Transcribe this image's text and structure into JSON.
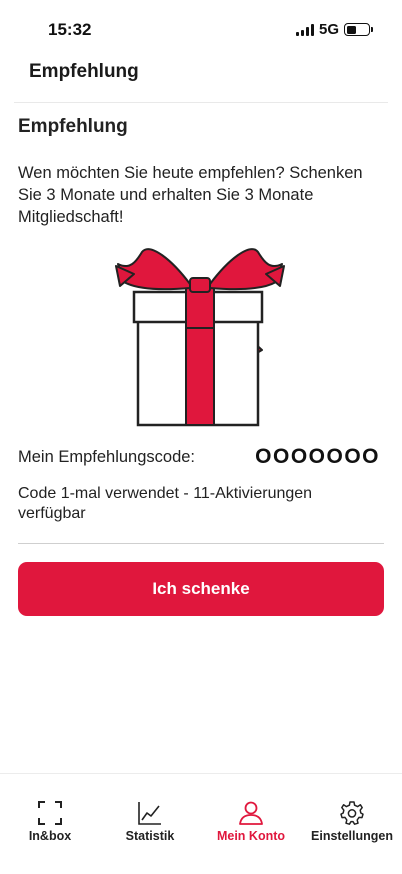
{
  "status_bar": {
    "time": "15:32",
    "network": "5G"
  },
  "header": {
    "title": "Empfehlung"
  },
  "referral": {
    "title": "Empfehlung",
    "intro": "Wen möchten Sie heute empfehlen? Schenken Sie 3 Monate und erhalten Sie 3 Monate Mitgliedschaft!",
    "code_label": "Mein Empfehlungscode:",
    "code_value": "OOOOOOO",
    "usage_text": "Code 1-mal verwendet - 11-Aktivierungen verfügbar",
    "cta_label": "Ich schenke"
  },
  "tabbar": {
    "tabs": [
      {
        "label": "In&box",
        "icon": "scan-frame-icon"
      },
      {
        "label": "Statistik",
        "icon": "line-chart-icon"
      },
      {
        "label": "Mein Konto",
        "icon": "person-icon",
        "active": true
      },
      {
        "label": "Einstellungen",
        "icon": "gear-icon"
      }
    ]
  },
  "colors": {
    "accent": "#e0173d",
    "text": "#1a1a1a",
    "divider": "#cfcfcf"
  }
}
